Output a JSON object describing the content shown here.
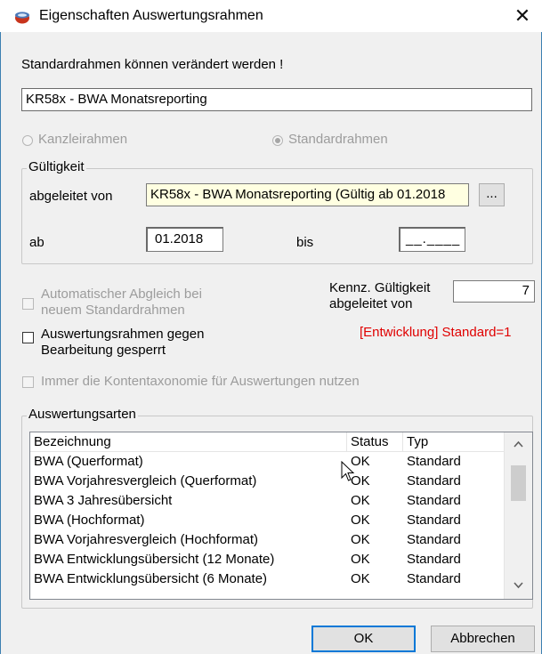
{
  "window": {
    "title": "Eigenschaften Auswertungsrahmen"
  },
  "info_text": "Standardrahmen können verändert werden !",
  "name_value": "KR58x - BWA Monatsreporting",
  "radios": {
    "kanzlei": "Kanzleirahmen",
    "standard": "Standardrahmen"
  },
  "gueltigkeit": {
    "legend": "Gültigkeit",
    "abgeleitet_label": "abgeleitet von",
    "abgeleitet_value": "KR58x - BWA Monatsreporting (Gültig ab 01.2018",
    "browse_label": "...",
    "ab_label": "ab",
    "ab_value": "01.2018",
    "bis_label": "bis",
    "bis_value": "__.____"
  },
  "options": {
    "auto_abgleich": "Automatischer Abgleich bei neuem Standardrahmen",
    "gesperrt": "Auswertungsrahmen gegen Bearbeitung gesperrt",
    "kontentaxonomie": "Immer die Kontentaxonomie für Auswertungen nutzen"
  },
  "kennz": {
    "label_line1": "Kennz. Gültigkeit",
    "label_line2": "abgeleitet von",
    "value": "7",
    "info": "[Entwicklung] Standard=1"
  },
  "auswertungsarten": {
    "legend": "Auswertungsarten",
    "columns": [
      "Bezeichnung",
      "Status",
      "Typ"
    ],
    "rows": [
      [
        "BWA (Querformat)",
        "OK",
        "Standard"
      ],
      [
        "BWA Vorjahresvergleich (Querformat)",
        "OK",
        "Standard"
      ],
      [
        "BWA 3 Jahresübersicht",
        "OK",
        "Standard"
      ],
      [
        "BWA (Hochformat)",
        "OK",
        "Standard"
      ],
      [
        "BWA Vorjahresvergleich (Hochformat)",
        "OK",
        "Standard"
      ],
      [
        "BWA Entwicklungsübersicht (12 Monate)",
        "OK",
        "Standard"
      ],
      [
        "BWA Entwicklungsübersicht (6 Monate)",
        "OK",
        "Standard"
      ]
    ]
  },
  "buttons": {
    "ok": "OK",
    "cancel": "Abbrechen"
  },
  "colors": {
    "info_red": "#e00000",
    "field_highlight": "#ffffe1",
    "frame_blue": "#3c7fb1"
  }
}
